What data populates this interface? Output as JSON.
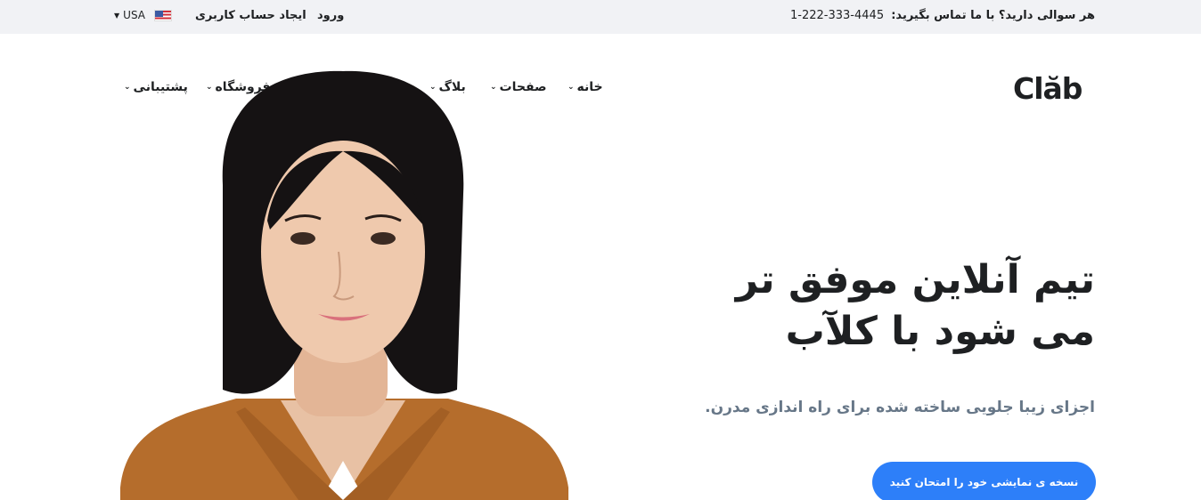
{
  "topbar": {
    "contact_label": "هر سوالی دارید؟ با ما تماس بگیرید:",
    "phone": "1-222-333-4445",
    "login": "ورود",
    "signup": "ایجاد حساب کاربری",
    "language": "USA",
    "flag_icon": "us-flag-icon"
  },
  "brand": {
    "logo": "Clăb"
  },
  "nav": {
    "items": [
      {
        "label": "خانه"
      },
      {
        "label": "صفحات"
      },
      {
        "label": "بلاگ"
      },
      {
        "label": "فروشگاه"
      },
      {
        "label": "پشتیبانی"
      }
    ]
  },
  "hero": {
    "title": "تیم آنلاین موفق تر می شود با کلآب",
    "subtitle": "اجزای زیبا جلویی ساخته شده برای راه اندازی مدرن.",
    "cta": "نسخه ی نمایشی خود را امتحان کنید"
  },
  "colors": {
    "accent": "#2d7ff9",
    "topbar_bg": "#f1f2f5",
    "text": "#1e2022",
    "muted": "#677788"
  }
}
